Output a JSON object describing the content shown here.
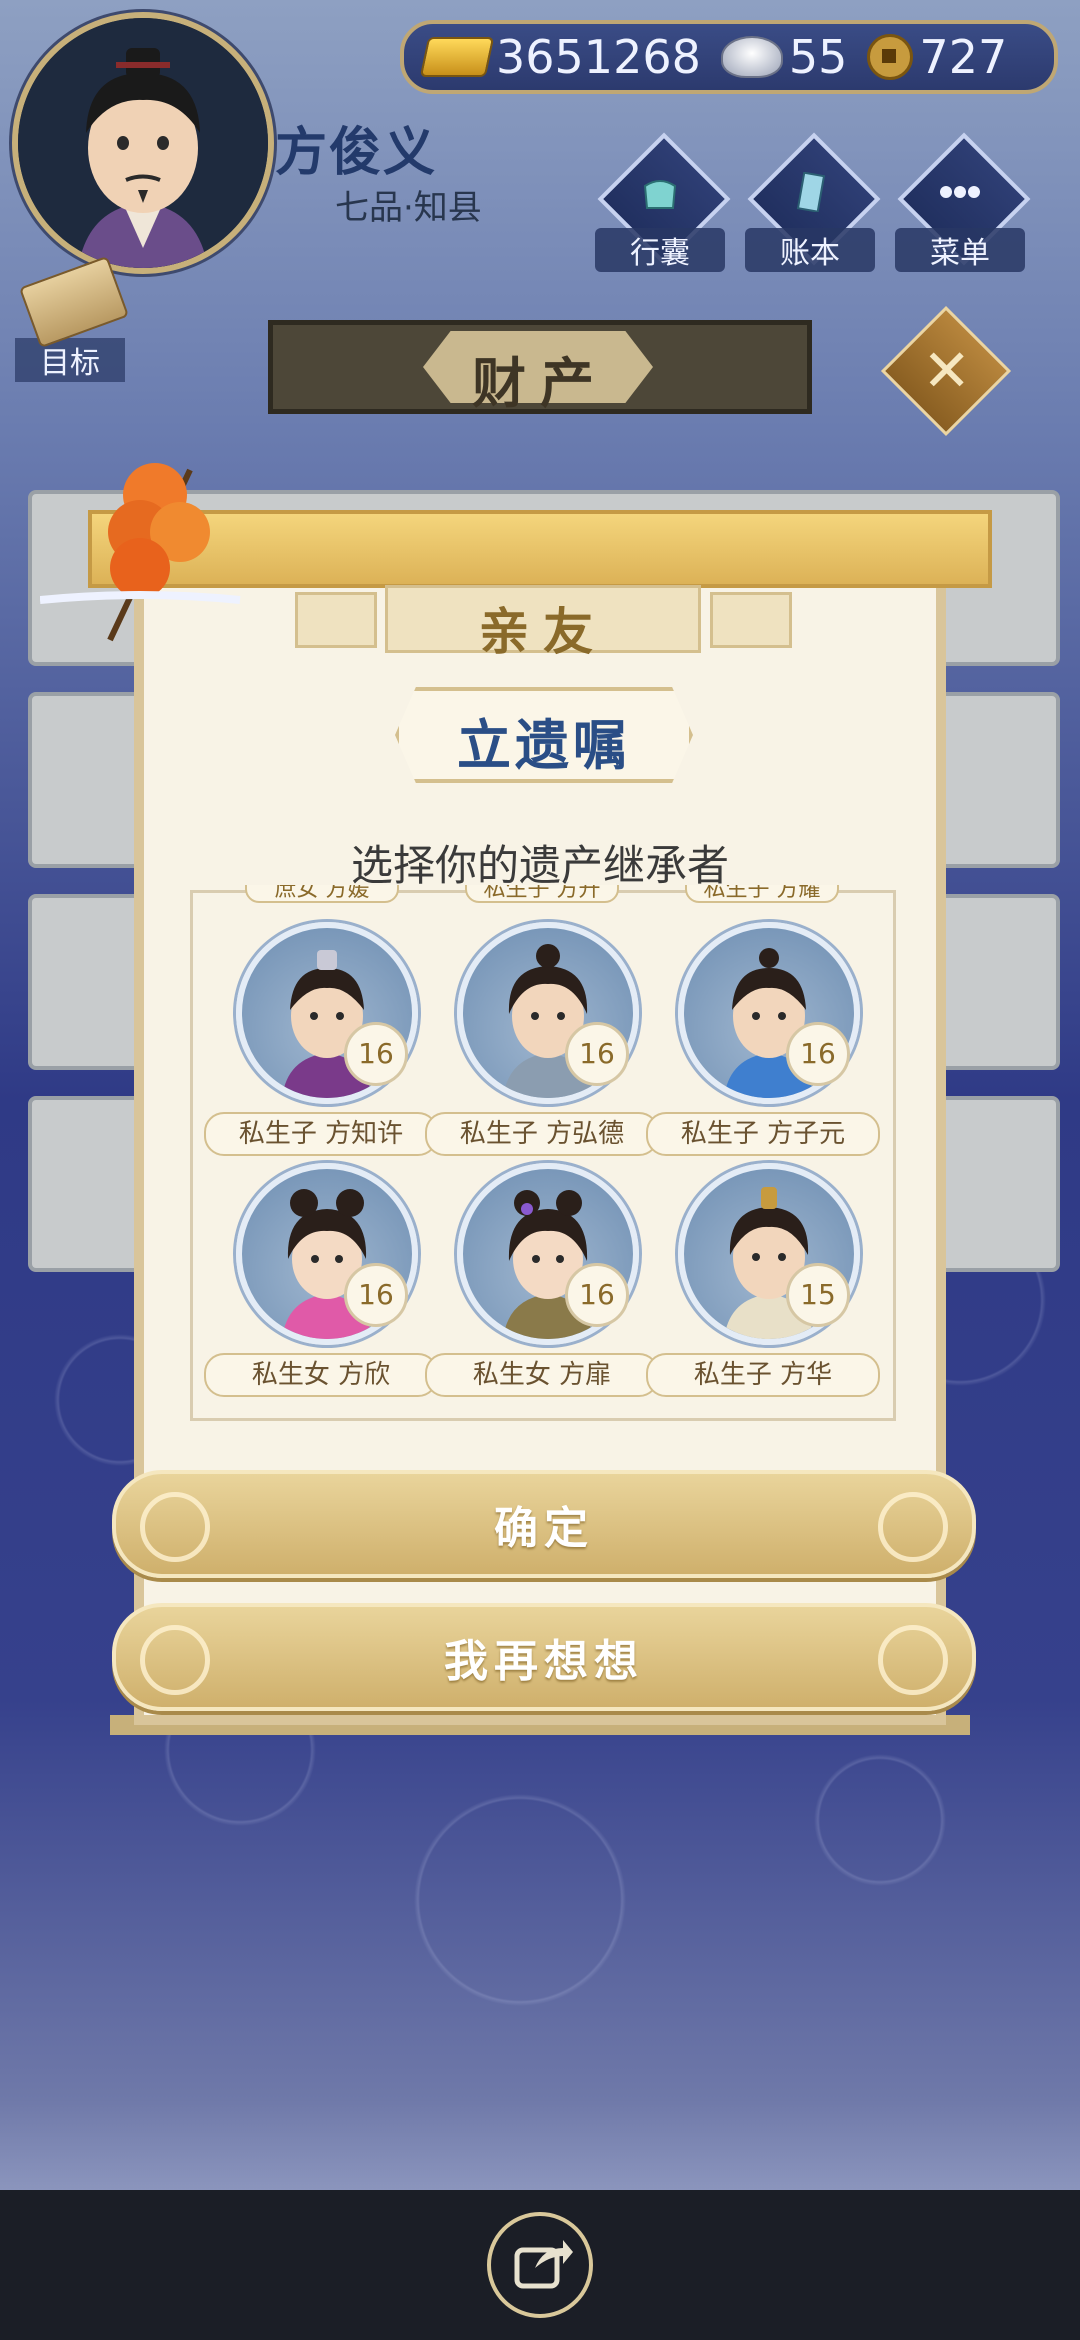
{
  "player": {
    "name": "方俊义",
    "rank": "七品·知县"
  },
  "currency": {
    "gold": "3651268",
    "silver": "55",
    "coins": "727"
  },
  "menu": {
    "bag": "行囊",
    "ledger": "账本",
    "menu": "菜单",
    "goal": "目标"
  },
  "section_title": "财产",
  "dialog": {
    "tab_title": "亲友",
    "will_title": "立遗嘱",
    "subtitle": "选择你的遗产继承者",
    "partial_names": [
      "庶女 方媛",
      "私生子 方升",
      "私生子 方耀"
    ],
    "heirs": [
      {
        "name": "私生子 方知许",
        "age": "16"
      },
      {
        "name": "私生子 方弘德",
        "age": "16"
      },
      {
        "name": "私生子 方子元",
        "age": "16"
      },
      {
        "name": "私生女 方欣",
        "age": "16"
      },
      {
        "name": "私生女 方扉",
        "age": "16"
      },
      {
        "name": "私生子 方华",
        "age": "15"
      }
    ],
    "confirm": "确定",
    "rethink": "我再想想"
  },
  "colors": {
    "accent_gold": "#d9c59a",
    "title_blue": "#2a4e86",
    "background_blue": "#2f3a86"
  }
}
